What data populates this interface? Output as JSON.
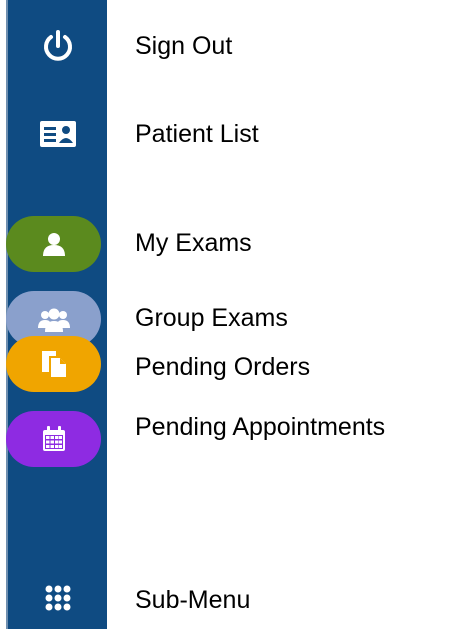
{
  "menu": {
    "items": [
      {
        "label": "Sign Out",
        "icon": "power-icon"
      },
      {
        "label": "Patient List",
        "icon": "id-card-icon"
      },
      {
        "label": "My Exams",
        "icon": "user-icon",
        "color": "#5b8a1e"
      },
      {
        "label": "Group Exams",
        "icon": "users-icon",
        "color": "#8aa0cc"
      },
      {
        "label": "Pending Orders",
        "icon": "documents-icon",
        "color": "#f0a500"
      },
      {
        "label": "Pending Appointments",
        "icon": "calendar-icon",
        "color": "#8e2be2"
      },
      {
        "label": "Sub-Menu",
        "icon": "grid-icon"
      }
    ]
  },
  "colors": {
    "sidebar": "#0f4b82",
    "icon": "#ffffff"
  }
}
